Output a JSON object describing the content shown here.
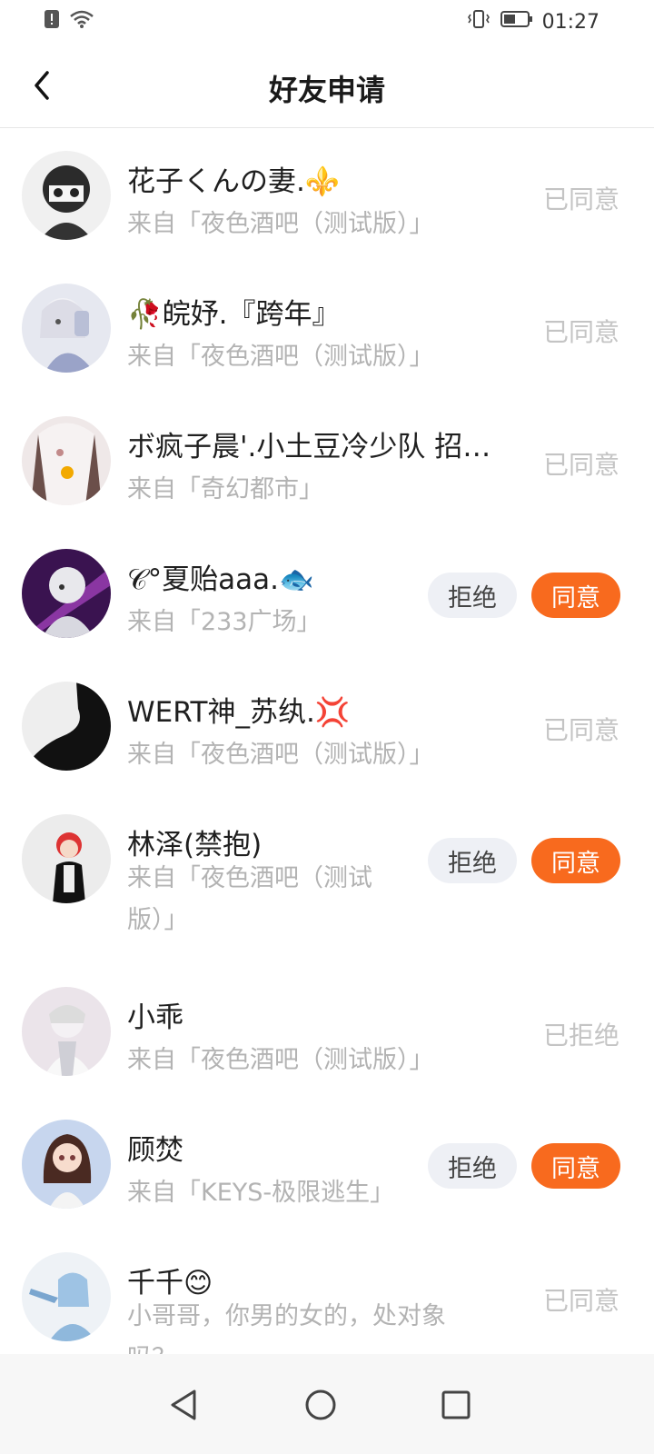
{
  "status_bar": {
    "time": "01:27"
  },
  "header": {
    "title": "好友申请"
  },
  "requests": [
    {
      "name": "花子くんの妻.⚜️",
      "source": "来自「夜色酒吧（测试版）」",
      "status": "已同意",
      "avatar_color": "#2b2b2b"
    },
    {
      "name": "🥀皖妤.『跨年』",
      "source": "来自「夜色酒吧（测试版）」",
      "status": "已同意",
      "avatar_color": "#c9cde0"
    },
    {
      "name": "ボ疯子晨'.小土豆冷少队 招…",
      "source": "来自「奇幻都市」",
      "status": "已同意",
      "avatar_color": "#d8cfd0"
    },
    {
      "name": "𝒞°夏贻aaa.🐟",
      "source": "来自「233广场」",
      "reject_label": "拒绝",
      "agree_label": "同意",
      "avatar_color": "#4a1f5c"
    },
    {
      "name": "WERT神_苏纨.💢",
      "source": "来自「夜色酒吧（测试版）」",
      "status": "已同意",
      "avatar_color": "#111111"
    },
    {
      "name": "林泽(禁抱)",
      "source": "来自「夜色酒吧（测试版）」",
      "reject_label": "拒绝",
      "agree_label": "同意",
      "avatar_color": "#e8e8e8"
    },
    {
      "name": "小乖",
      "source": "来自「夜色酒吧（测试版）」",
      "status": "已拒绝",
      "avatar_color": "#ddd6de"
    },
    {
      "name": "顾焚",
      "source": "来自「KEYS-极限逃生」",
      "reject_label": "拒绝",
      "agree_label": "同意",
      "avatar_color": "#b58a7a"
    },
    {
      "name": "千千😊",
      "source": "小哥哥，你男的女的，处对象吗？",
      "status": "已同意",
      "avatar_color": "#d6e4ef"
    }
  ],
  "colors": {
    "accent": "#f86a1e",
    "muted": "#c4c4c4"
  }
}
